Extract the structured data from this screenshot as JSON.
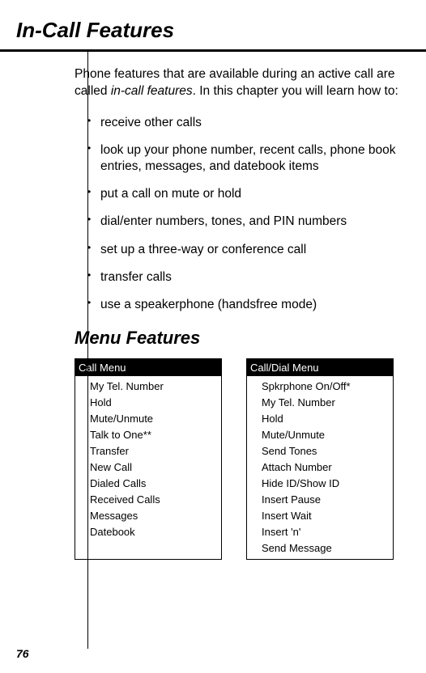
{
  "page": {
    "title": "In-Call Features",
    "intro_prefix": "Phone features that are available during an active call are called ",
    "intro_em": "in-call features",
    "intro_suffix": ". In this chapter you will learn how to:",
    "bullets": {
      "b0": "receive other calls",
      "b1": "look up your phone number, recent calls, phone book entries, messages, and datebook items",
      "b2": "put a call on mute or hold",
      "b3": "dial/enter numbers, tones, and PIN numbers",
      "b4": "set up a three-way or conference call",
      "b5": "transfer calls",
      "b6": "use a speakerphone (handsfree mode)"
    },
    "section_title": "Menu Features",
    "menu1": {
      "header": "Call Menu",
      "items": {
        "i0": "My Tel. Number",
        "i1": "Hold",
        "i2": "Mute/Unmute",
        "i3": "Talk to One**",
        "i4": "Transfer",
        "i5": "New Call",
        "i6": "Dialed Calls",
        "i7": "Received Calls",
        "i8": "Messages",
        "i9": "Datebook"
      }
    },
    "menu2": {
      "header": "Call/Dial Menu",
      "items": {
        "i0": "Spkrphone On/Off*",
        "i1": "My Tel. Number",
        "i2": "Hold",
        "i3": "Mute/Unmute",
        "i4": "Send Tones",
        "i5": "Attach Number",
        "i6": "Hide ID/Show ID",
        "i7": "Insert Pause",
        "i8": "Insert Wait",
        "i9": "Insert 'n'",
        "i10": "Send Message"
      }
    },
    "page_number": "76"
  }
}
